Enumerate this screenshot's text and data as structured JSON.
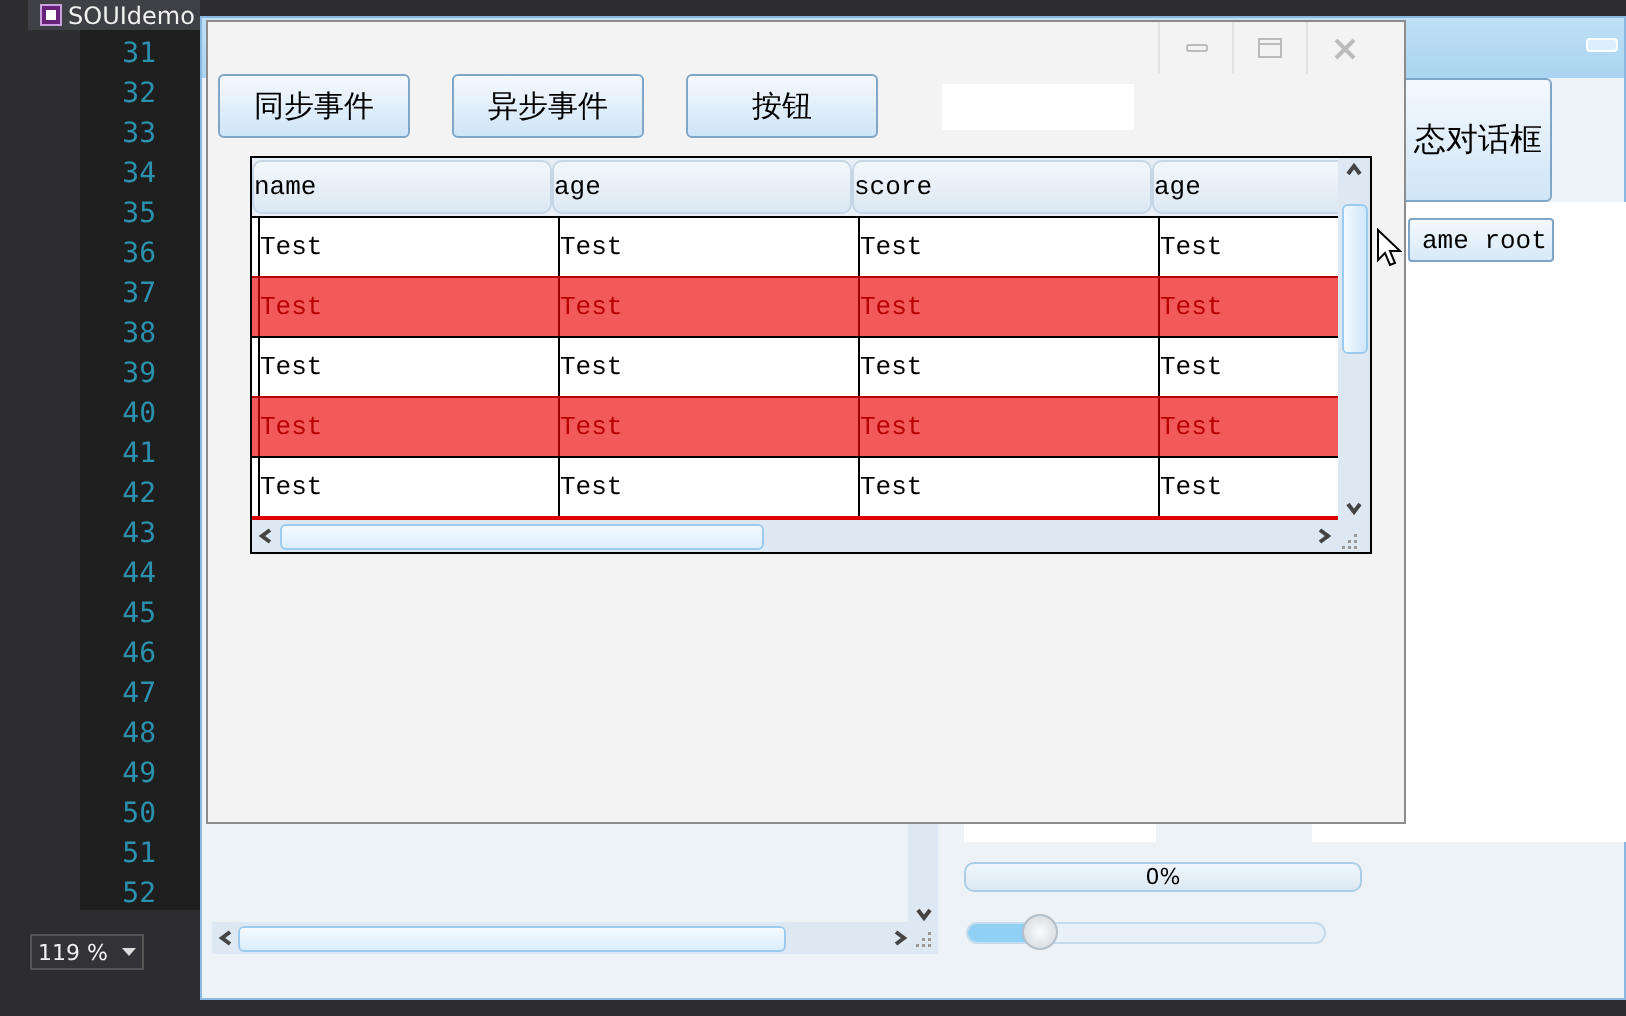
{
  "ide": {
    "tab": "SOUIdemo",
    "line_numbers": [
      "31",
      "32",
      "33",
      "34",
      "35",
      "36",
      "37",
      "38",
      "39",
      "40",
      "41",
      "42",
      "43",
      "44",
      "45",
      "46",
      "47",
      "48",
      "49",
      "50",
      "51",
      "52"
    ],
    "zoom": "119 %"
  },
  "back_window": {
    "dialog_button": "态对话框",
    "root_button": "ame root",
    "progress": {
      "label": "0%",
      "level": 0
    },
    "slider": {
      "level": 0.2
    }
  },
  "dialog": {
    "buttons": [
      "同步事件",
      "异步事件",
      "按钮"
    ],
    "table": {
      "columns": [
        "name",
        "age",
        "score",
        "age"
      ],
      "rows": [
        {
          "highlighted": false,
          "cells": [
            "Test",
            "Test",
            "Test",
            "Test"
          ]
        },
        {
          "highlighted": true,
          "cells": [
            "Test",
            "Test",
            "Test",
            "Test"
          ]
        },
        {
          "highlighted": false,
          "cells": [
            "Test",
            "Test",
            "Test",
            "Test"
          ]
        },
        {
          "highlighted": true,
          "cells": [
            "Test",
            "Test",
            "Test",
            "Test"
          ]
        },
        {
          "highlighted": false,
          "cells": [
            "Test",
            "Test",
            "Test",
            "Test"
          ]
        }
      ]
    }
  }
}
